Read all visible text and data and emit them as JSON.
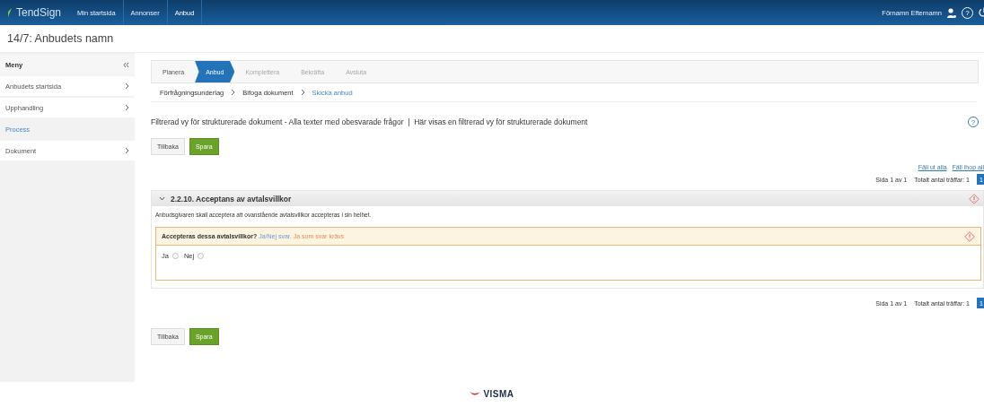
{
  "topbar": {
    "brand": "TendSign",
    "nav": [
      {
        "label": "Min startsida",
        "selected": false
      },
      {
        "label": "Annonser",
        "selected": false
      },
      {
        "label": "Anbud",
        "selected": true
      }
    ],
    "user": "Förnamn Efternamn",
    "help": "?"
  },
  "page_title": "14/7: Anbudets namn",
  "sidebar": {
    "title": "Meny",
    "items": [
      {
        "label": "Anbudets startsida",
        "selected": false,
        "expandable": true
      },
      {
        "label": "Upphandling",
        "selected": false,
        "expandable": true
      },
      {
        "label": "Process",
        "selected": true,
        "expandable": false
      },
      {
        "label": "Dokument",
        "selected": false,
        "expandable": true
      }
    ]
  },
  "steps": [
    {
      "label": "Planera",
      "kind": "done"
    },
    {
      "label": "Anbud",
      "kind": "active"
    },
    {
      "label": "Komplettera",
      "kind": "disabled"
    },
    {
      "label": "Bekräfta",
      "kind": "disabled"
    },
    {
      "label": "Avsluta",
      "kind": "disabled"
    }
  ],
  "breadcrumbs": [
    {
      "label": "Förfrågningsunderlag",
      "selected": false
    },
    {
      "label": "Bifoga dokument",
      "selected": false
    },
    {
      "label": "Skicka anbud",
      "selected": true
    }
  ],
  "filter_text": "Filtrerad vy för strukturerade dokument - Alla texter med obesvarade frågor  |  Här visas en filtrerad vy för strukturerade dokument",
  "help": "?",
  "buttons_top": [
    {
      "label": "Tillbaka",
      "kind": "secondary"
    },
    {
      "label": "Spara",
      "kind": "primary"
    }
  ],
  "expand_links": [
    "Fäll ut alla",
    "Fäll ihop all"
  ],
  "pagination_top": {
    "page_info": "Sida 1 av 1",
    "total": "Totalt antal träffar: 1",
    "page": "1"
  },
  "section": {
    "title": "2.2.10. Acceptans av avtalsvillkor",
    "expanded": true,
    "description": "Anbudsgivaren skall acceptera att ovanstående avtalsvillkor accepteras i sin helhet.",
    "question": {
      "label": "Accepteras dessa avtalsvillkor?",
      "hint": "Ja/Nej svar.",
      "requirement": "Ja som svar krävs",
      "options": [
        {
          "label": "Ja",
          "selected": false
        },
        {
          "label": "Nej",
          "selected": false
        }
      ]
    }
  },
  "pagination_bottom": {
    "page_info": "Sida 1 av 1",
    "total": "Totalt antal träffar: 1",
    "page": "1"
  },
  "buttons_bottom": [
    {
      "label": "Tillbaka",
      "kind": "secondary"
    },
    {
      "label": "Spara",
      "kind": "primary"
    }
  ],
  "footer": {
    "logo": "VISMA"
  }
}
